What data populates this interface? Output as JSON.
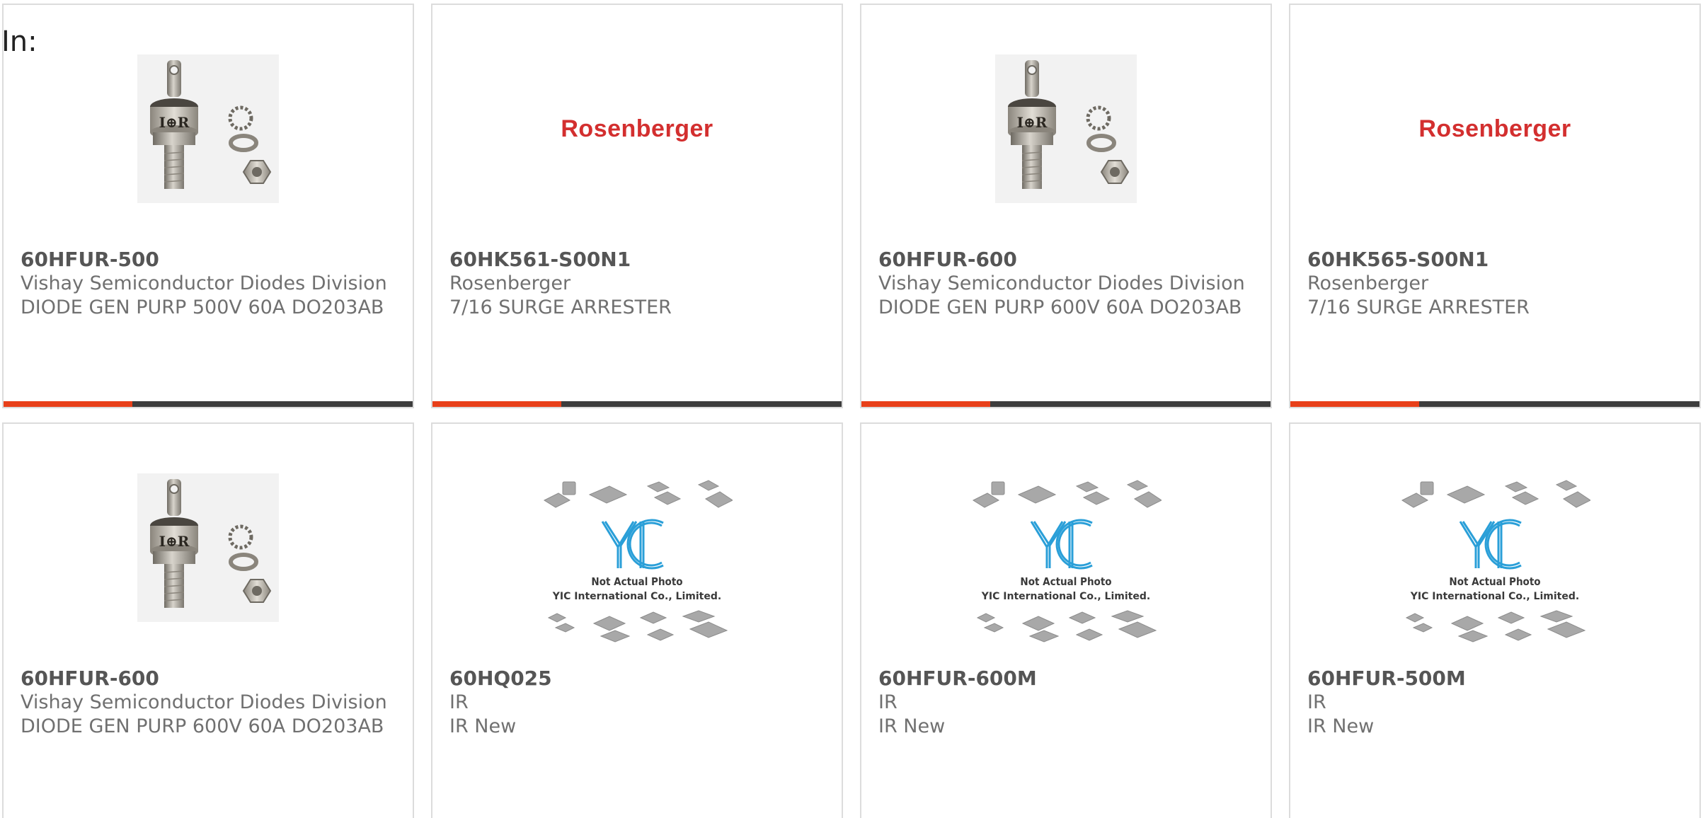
{
  "header": {
    "in_label": "In:"
  },
  "colors": {
    "accent": "#e8401a",
    "bar": "#3d3d3d",
    "brand_red": "#d32f2f",
    "yic_blue": "#2a9fd8"
  },
  "products": [
    {
      "part": "60HFUR-500",
      "manufacturer": "Vishay Semiconductor Diodes Division",
      "description": "DIODE GEN PURP 500V 60A DO203AB",
      "image": "stud-diode-photo"
    },
    {
      "part": "60HK561-S00N1",
      "manufacturer": "Rosenberger",
      "description": "7/16 SURGE ARRESTER",
      "image": "rosenberger-logo",
      "logo_text": "Rosenberger"
    },
    {
      "part": "60HFUR-600",
      "manufacturer": "Vishay Semiconductor Diodes Division",
      "description": "DIODE GEN PURP 600V 60A DO203AB",
      "image": "stud-diode-photo"
    },
    {
      "part": "60HK565-S00N1",
      "manufacturer": "Rosenberger",
      "description": "7/16 SURGE ARRESTER",
      "image": "rosenberger-logo",
      "logo_text": "Rosenberger"
    },
    {
      "part": "60HFUR-600",
      "manufacturer": "Vishay Semiconductor Diodes Division",
      "description": "DIODE GEN PURP 600V 60A DO203AB",
      "image": "stud-diode-photo"
    },
    {
      "part": "60HQ025",
      "manufacturer": "IR",
      "description": "IR New",
      "image": "yic-placeholder",
      "placeholder_line1": "Not Actual Photo",
      "placeholder_line2": "YIC International Co., Limited."
    },
    {
      "part": "60HFUR-600M",
      "manufacturer": "IR",
      "description": "IR New",
      "image": "yic-placeholder",
      "placeholder_line1": "Not Actual Photo",
      "placeholder_line2": "YIC International Co., Limited."
    },
    {
      "part": "60HFUR-500M",
      "manufacturer": "IR",
      "description": "IR New",
      "image": "yic-placeholder",
      "placeholder_line1": "Not Actual Photo",
      "placeholder_line2": "YIC International Co., Limited."
    }
  ]
}
